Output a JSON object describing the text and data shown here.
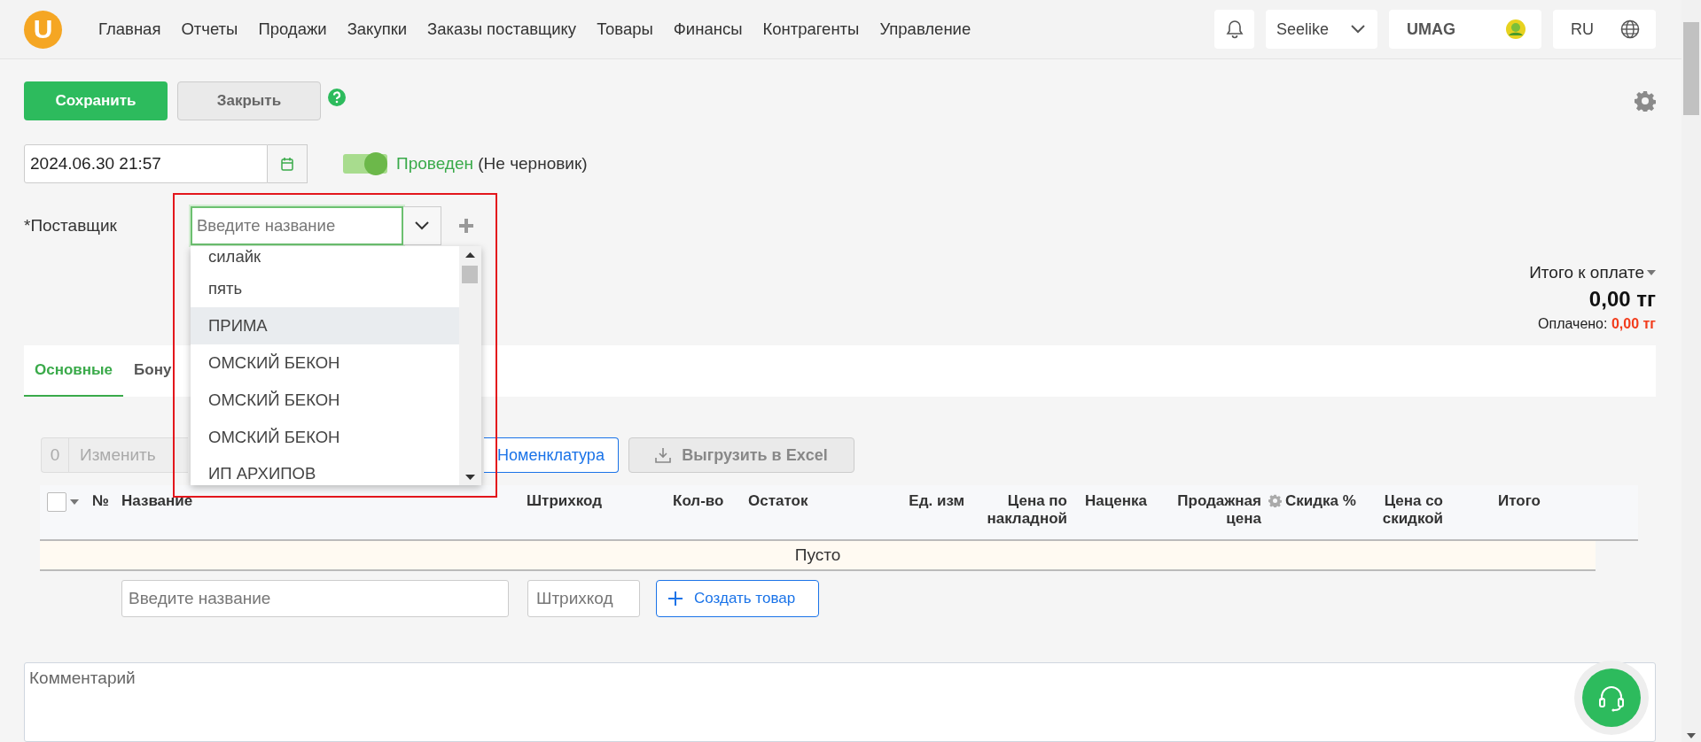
{
  "nav": {
    "logo": "U",
    "items": [
      "Главная",
      "Отчеты",
      "Продажи",
      "Закупки",
      "Заказы поставщику",
      "Товары",
      "Финансы",
      "Контрагенты",
      "Управление"
    ],
    "account": "Seelike",
    "store": "UMAG",
    "language": "RU"
  },
  "actions": {
    "save": "Сохранить",
    "close": "Закрыть"
  },
  "document": {
    "date": "2024.06.30 21:57",
    "posted": true,
    "status_label": "Проведен",
    "status_note": "(Не черновик)"
  },
  "supplier": {
    "label": "*Поставщик",
    "placeholder": "Введите название",
    "options": [
      {
        "label": "силайк",
        "selected": false
      },
      {
        "label": "пять",
        "selected": false
      },
      {
        "label": "ПРИМА",
        "selected": true
      },
      {
        "label": "ОМСКИЙ БЕКОН",
        "selected": false
      },
      {
        "label": "ОМСКИЙ БЕКОН",
        "selected": false
      },
      {
        "label": "ОМСКИЙ БЕКОН",
        "selected": false
      },
      {
        "label": "ИП АРХИПОВ",
        "selected": false
      }
    ]
  },
  "totals": {
    "label": "Итого к оплате",
    "amount": "0,00 тг",
    "paid_label": "Оплачено:",
    "paid_amount": "0,00 тг"
  },
  "tabs": [
    {
      "label": "Основные",
      "selected": true
    },
    {
      "label": "Бону",
      "selected": false
    }
  ],
  "toolbar": {
    "count": "0",
    "edit": "Изменить",
    "nomenclature": "Номенклатура",
    "export": "Выгрузить в Excel"
  },
  "table": {
    "select_all": {
      "checked": false
    },
    "columns": [
      {
        "label": "№",
        "kind": "text"
      },
      {
        "label": "Название",
        "kind": "text"
      },
      {
        "label": "Штрихкод",
        "kind": "text"
      },
      {
        "label": "Кол-во",
        "kind": "text"
      },
      {
        "label": "Остаток",
        "kind": "text"
      },
      {
        "label": "Ед. изм",
        "kind": "text"
      },
      {
        "label": "Цена по накладной",
        "kind": "text"
      },
      {
        "label": "Наценка",
        "kind": "text"
      },
      {
        "label": "Продажная цена",
        "kind": "text"
      },
      {
        "label": "Скидка %",
        "kind": "settings"
      },
      {
        "label": "Цена со скидкой",
        "kind": "text"
      },
      {
        "label": "Итого",
        "kind": "text"
      }
    ],
    "empty": "Пусто",
    "name_placeholder": "Введите название",
    "barcode_placeholder": "Штрихкод",
    "create": "Создать товар"
  },
  "comment": {
    "placeholder": "Комментарий"
  }
}
